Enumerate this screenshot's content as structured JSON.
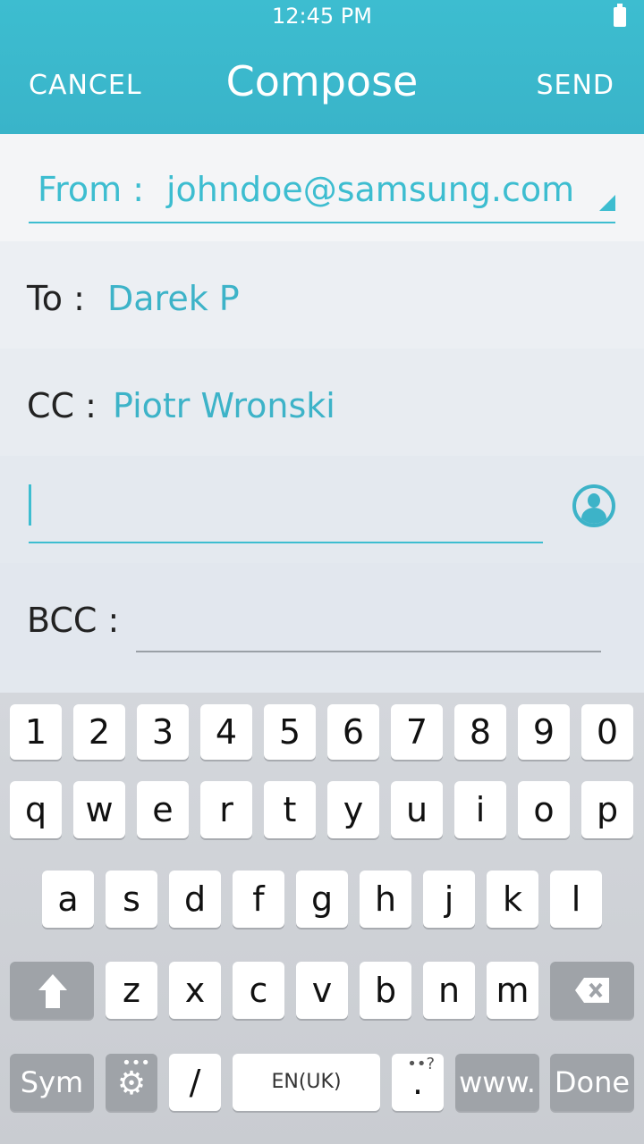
{
  "status_bar": {
    "time": "12:45 PM"
  },
  "header": {
    "cancel": "CANCEL",
    "title": "Compose",
    "send": "SEND"
  },
  "from": {
    "label": "From :",
    "value": "johndoe@samsung.com"
  },
  "to": {
    "label": "To :",
    "value": "Darek P"
  },
  "cc": {
    "label": "CC :",
    "value": "Piotr Wronski"
  },
  "bcc": {
    "label": "BCC :"
  },
  "keyboard": {
    "numbers": [
      "1",
      "2",
      "3",
      "4",
      "5",
      "6",
      "7",
      "8",
      "9",
      "0"
    ],
    "row1": [
      "q",
      "w",
      "e",
      "r",
      "t",
      "y",
      "u",
      "i",
      "o",
      "p"
    ],
    "row2": [
      "a",
      "s",
      "d",
      "f",
      "g",
      "h",
      "j",
      "k",
      "l"
    ],
    "row3": [
      "z",
      "x",
      "c",
      "v",
      "b",
      "n",
      "m"
    ],
    "sym": "Sym",
    "slash": "/",
    "space": "EN(UK)",
    "dot": ".",
    "dot_hint": "?",
    "www": "www.",
    "done": "Done"
  },
  "colors": {
    "accent": "#3dbdd0",
    "header_bg": "#3dbdd0"
  }
}
